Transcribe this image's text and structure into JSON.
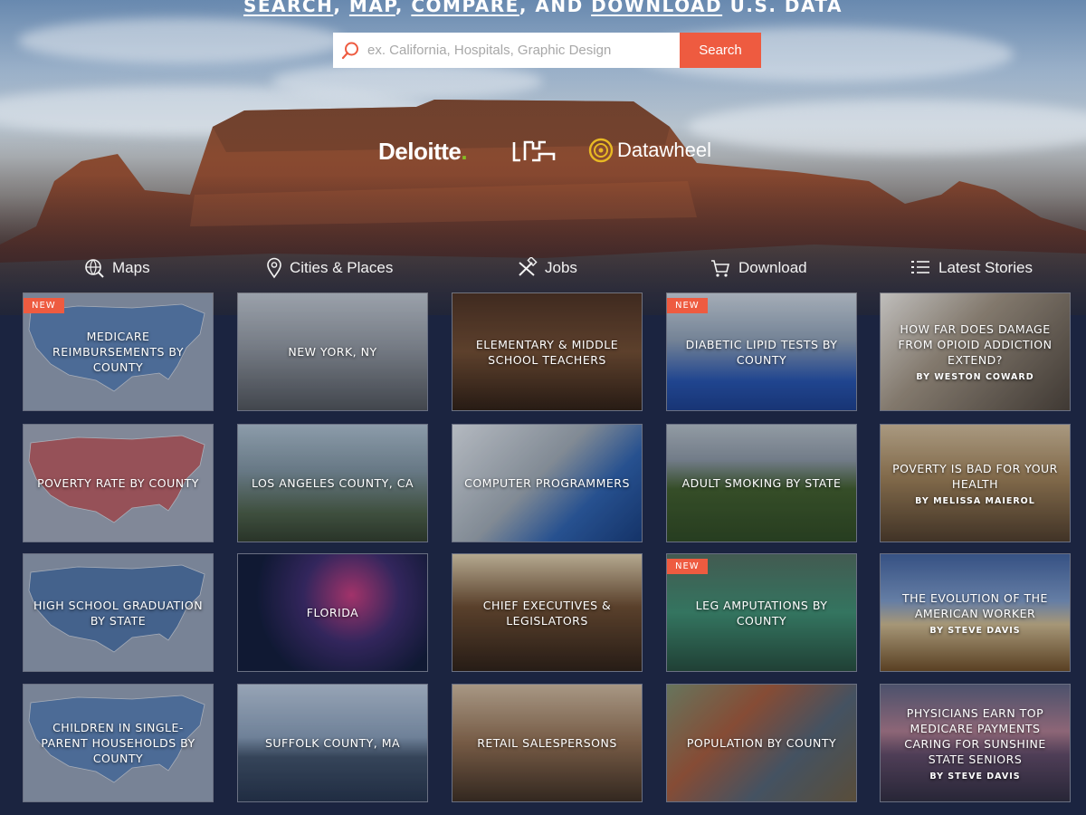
{
  "hero": {
    "tagline_parts": [
      "SEARCH",
      ", ",
      "MAP",
      ", ",
      "COMPARE",
      ", AND ",
      "DOWNLOAD",
      " U.S. DATA"
    ],
    "search": {
      "placeholder": "ex. California, Hospitals, Graphic Design",
      "value": "",
      "button_label": "Search"
    },
    "logos": {
      "deloitte": "Deloitte",
      "deloitte_dot": ".",
      "datawheel": "Datawheel"
    }
  },
  "nav": {
    "items": [
      {
        "label": "Maps",
        "icon": "globe-search-icon"
      },
      {
        "label": "Cities & Places",
        "icon": "map-pin-icon"
      },
      {
        "label": "Jobs",
        "icon": "tools-icon"
      },
      {
        "label": "Download",
        "icon": "cart-icon"
      },
      {
        "label": "Latest Stories",
        "icon": "list-icon"
      }
    ]
  },
  "tiles": [
    {
      "title": "Medicare Reimbursements by County",
      "badge": "NEW",
      "byline": ""
    },
    {
      "title": "New York, NY",
      "badge": "",
      "byline": ""
    },
    {
      "title": "Elementary & Middle School Teachers",
      "badge": "",
      "byline": ""
    },
    {
      "title": "Diabetic Lipid Tests by County",
      "badge": "NEW",
      "byline": ""
    },
    {
      "title": "How Far Does Damage from Opioid Addiction Extend?",
      "badge": "",
      "byline": "By Weston Coward"
    },
    {
      "title": "Poverty Rate by County",
      "badge": "",
      "byline": ""
    },
    {
      "title": "Los Angeles County, CA",
      "badge": "",
      "byline": ""
    },
    {
      "title": "Computer Programmers",
      "badge": "",
      "byline": ""
    },
    {
      "title": "Adult Smoking by State",
      "badge": "",
      "byline": ""
    },
    {
      "title": "Poverty is Bad for Your Health",
      "badge": "",
      "byline": "By Melissa Maierol"
    },
    {
      "title": "High School Graduation by State",
      "badge": "",
      "byline": ""
    },
    {
      "title": "Florida",
      "badge": "",
      "byline": ""
    },
    {
      "title": "Chief Executives & Legislators",
      "badge": "",
      "byline": ""
    },
    {
      "title": "Leg Amputations by County",
      "badge": "NEW",
      "byline": ""
    },
    {
      "title": "The Evolution of the American Worker",
      "badge": "",
      "byline": "By Steve Davis"
    },
    {
      "title": "Children in Single-Parent Households by County",
      "badge": "",
      "byline": ""
    },
    {
      "title": "Suffolk County, MA",
      "badge": "",
      "byline": ""
    },
    {
      "title": "Retail Salespersons",
      "badge": "",
      "byline": ""
    },
    {
      "title": "Population by County",
      "badge": "",
      "byline": ""
    },
    {
      "title": "Physicians Earn Top Medicare Payments Caring for Sunshine State Seniors",
      "badge": "",
      "byline": "By Steve Davis"
    }
  ],
  "colors": {
    "accent": "#ee5b40",
    "page_bg": "#1b2440",
    "deloitte_green": "#86bc25",
    "datawheel_gold": "#e8b923"
  }
}
